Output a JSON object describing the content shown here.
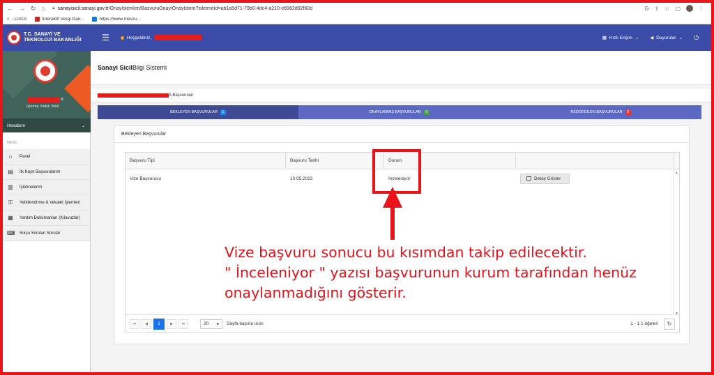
{
  "browser": {
    "url_host": "sanayisicil.sanayi.gov.tr",
    "url_path": "/OnayIslemleri/BasvuruOnay/OnayIstem?isletmeId=ab1a5d71-79b0-4dc4-a210-e6962d92f60d",
    "bookmarks": [
      "- LUCA",
      "İnteraktif Vergi Dair...",
      "https://www.mevzu..."
    ]
  },
  "header": {
    "logo_line1": "T.C. SANAYİ VE",
    "logo_line2": "TEKNOLOJİ BAKANLIĞI",
    "welcome": "Hoşgeldiniz, ",
    "quick_access": "Hızlı Erişim",
    "announcements": "Duyurular"
  },
  "sidebar": {
    "user_suffix": "A",
    "role": "İşletme Yetkili Vekil",
    "account": "Hesabım",
    "menu_label": "MENU",
    "items": [
      {
        "label": "Panel",
        "icon": "home-icon"
      },
      {
        "label": "İlk Kayıt Başvurularım",
        "icon": "document-icon"
      },
      {
        "label": "İşletmelerim",
        "icon": "building-icon"
      },
      {
        "label": "Yetkilendirme & Vekalet İşlemleri",
        "icon": "key-icon"
      },
      {
        "label": "Yardım Dokümanları (Kılavuzlar)",
        "icon": "book-icon"
      },
      {
        "label": "Sıkça Sorulan Sorular",
        "icon": "chat-icon"
      }
    ]
  },
  "page": {
    "title_bold": "Sanayi Sicil",
    "title_rest": " Bilgi Sistemi",
    "breadcrumb_suffix": "A Başvuruları"
  },
  "tabs": [
    {
      "label": "BEKLEYEN BAŞVURULAR",
      "count": "1",
      "color": "#1e88e5"
    },
    {
      "label": "ONAYLANMIŞ BAŞVURULAR",
      "count": "0",
      "color": "#43a047"
    },
    {
      "label": "REDDEDİLEN BAŞVURULAR",
      "count": "0",
      "color": "#e53935"
    }
  ],
  "card": {
    "title": "Bekleyen Başvurular",
    "columns": [
      "Başvuru Tipi",
      "Başvuru Tarihi",
      "Durum"
    ],
    "rows": [
      {
        "type": "Vize Başvurusu",
        "date": "10.05.2023",
        "status": "İnceleniyor",
        "action": "Detay Göster"
      }
    ]
  },
  "pager": {
    "current_page": "1",
    "page_size": "20",
    "page_size_label": "Sayfa başına ürün",
    "count_text": "1 - 1 1 öğeleri"
  },
  "annotation": {
    "line1": "Vize başvuru sonucu bu kısımdan takip edilecektir.",
    "line2": "\" İnceleniyor \" yazısı başvurunun kurum tarafından henüz",
    "line3": "onaylanmadığını gösterir."
  },
  "colors": {
    "header_blue": "#3b4ba8",
    "tab_active": "#3e4a94",
    "tab_inactive": "#5b69c4",
    "annotation_red": "#e8141a"
  }
}
